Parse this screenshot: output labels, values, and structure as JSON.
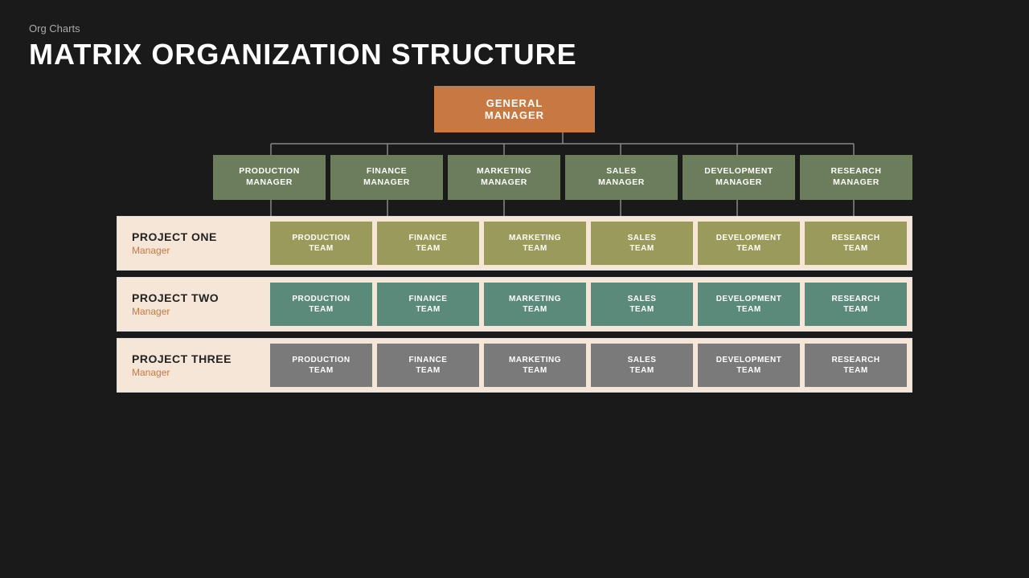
{
  "header": {
    "subtitle": "Org Charts",
    "title": "MATRIX ORGANIZATION STRUCTURE"
  },
  "gm": {
    "label": "GENERAL MANAGER"
  },
  "managers": [
    {
      "label": "PRODUCTION\nMANAGER"
    },
    {
      "label": "FINANCE\nMANAGER"
    },
    {
      "label": "MARKETING\nMANAGER"
    },
    {
      "label": "SALES\nMANAGER"
    },
    {
      "label": "DEVELOPMENT\nMANAGER"
    },
    {
      "label": "RESEARCH\nMANAGER"
    }
  ],
  "projects": [
    {
      "name": "PROJECT ONE",
      "manager": "Manager",
      "colorClass": "olive",
      "teams": [
        "PRODUCTION\nTEAM",
        "FINANCE\nTEAM",
        "MARKETING\nTEAM",
        "SALES\nTEAM",
        "DEVELOPMENT\nTEAM",
        "RESEARCH\nTEAM"
      ]
    },
    {
      "name": "PROJECT TWO",
      "manager": "Manager",
      "colorClass": "teal",
      "teams": [
        "PRODUCTION\nTEAM",
        "FINANCE\nTEAM",
        "MARKETING\nTEAM",
        "SALES\nTEAM",
        "DEVELOPMENT\nTEAM",
        "RESEARCH\nTEAM"
      ]
    },
    {
      "name": "PROJECT THREE",
      "manager": "Manager",
      "colorClass": "gray",
      "teams": [
        "PRODUCTION\nTEAM",
        "FINANCE\nTEAM",
        "MARKETING\nTEAM",
        "SALES\nTEAM",
        "DEVELOPMENT\nTEAM",
        "RESEARCH\nTEAM"
      ]
    }
  ]
}
